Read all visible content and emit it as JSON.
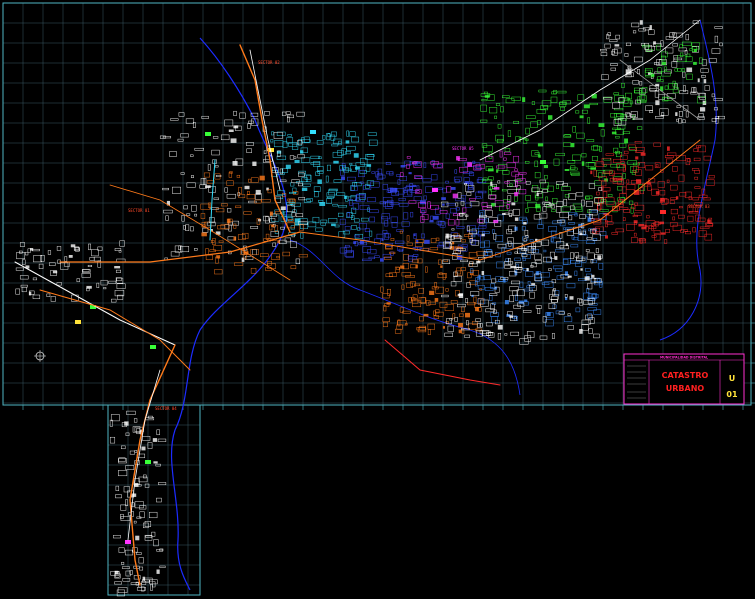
{
  "canvas": {
    "background": "#000000",
    "grid_color": "#3a5a64",
    "frame_color": "#4fb6c4"
  },
  "title_block": {
    "header": "MUNICIPALIDAD DISTRITAL",
    "title_line1": "CATASTRO",
    "title_line2": "URBANO",
    "sheet_letter": "U",
    "sheet_number": "01",
    "border_color": "#ff2fd0",
    "title_color": "#ff2020",
    "sheet_color": "#ffe23a"
  },
  "zones": [
    {
      "name": "sector-cyan",
      "color": "#33e0ff"
    },
    {
      "name": "sector-blue",
      "color": "#3a4cff"
    },
    {
      "name": "sector-green",
      "color": "#38ff38"
    },
    {
      "name": "sector-red",
      "color": "#ff2a2a"
    },
    {
      "name": "sector-orange",
      "color": "#ff7a1a"
    },
    {
      "name": "sector-white",
      "color": "#ffffff"
    },
    {
      "name": "sector-magenta",
      "color": "#ff33ff"
    }
  ],
  "labels": {
    "sector_west": "SECTOR 01",
    "sector_north": "SECTOR 02",
    "sector_east": "SECTOR 03",
    "sector_south": "SECTOR 04",
    "sector_mid": "SECTOR 05"
  },
  "north_symbol": "north-arrow-icon"
}
